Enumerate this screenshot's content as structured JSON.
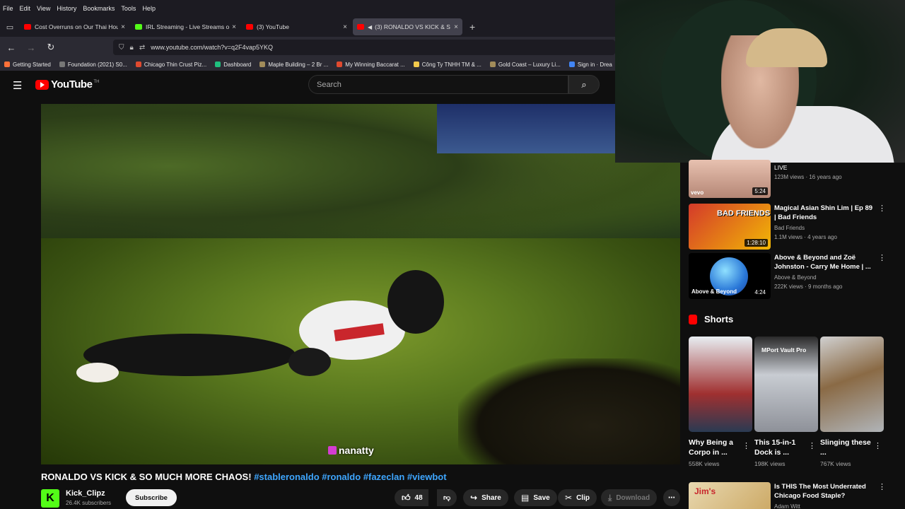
{
  "menu": [
    "File",
    "Edit",
    "View",
    "History",
    "Bookmarks",
    "Tools",
    "Help"
  ],
  "tabs": [
    {
      "title": "Cost Overruns on Our Thai Hou",
      "icon": "youtube-icon",
      "active": false
    },
    {
      "title": "IRL Streaming - Live Streams or",
      "icon": "kick-icon",
      "active": false
    },
    {
      "title": "(3) YouTube",
      "icon": "youtube-icon",
      "active": false
    },
    {
      "title": "(3) RONALDO VS KICK & S",
      "icon": "youtube-icon",
      "active": true
    }
  ],
  "url": "www.youtube.com/watch?v=q2F4vap5YKQ",
  "bookmarks": [
    {
      "label": "Getting Started",
      "color": "#ff7139"
    },
    {
      "label": "Foundation (2021) S0...",
      "color": "#777777"
    },
    {
      "label": "Chicago Thin Crust Piz...",
      "color": "#e04a2f"
    },
    {
      "label": "Dashboard",
      "color": "#1fbf7e"
    },
    {
      "label": "Maple Building – 2 Br ...",
      "color": "#a28c5a"
    },
    {
      "label": "My Winning Baccarat ...",
      "color": "#e04a2f"
    },
    {
      "label": "Công Ty TNHH TM & ...",
      "color": "#f2c94c"
    },
    {
      "label": "Gold Coast – Luxury Li...",
      "color": "#a28c5a"
    },
    {
      "label": "Sign in · Drea",
      "color": "#4285f4"
    }
  ],
  "youtube": {
    "logo_text": "YouTube",
    "logo_tm": "TH",
    "search_placeholder": "Search"
  },
  "video": {
    "watermark": "nanatty",
    "title_main": "RONALDO VS KICK & SO MUCH MORE CHAOS!",
    "hashtags": "#stableronaldo #ronaldo #fazeclan #viewbot",
    "channel_name": "Kick_Clipz",
    "channel_avatar_letter": "K",
    "subscribers": "26.4K subscribers",
    "subscribe_label": "Subscribe",
    "likes": "48",
    "share_label": "Share",
    "save_label": "Save",
    "clip_label": "Clip",
    "download_label": "Download"
  },
  "sidebar": {
    "items": [
      {
        "title": "",
        "channel": "LIVE",
        "meta": "123M views · 16 years ago",
        "duration": "5:24",
        "thumb_color": "#c49a8a",
        "badge": "vevo"
      },
      {
        "title": "Magical Asian Shin Lim | Ep 89 | Bad Friends",
        "channel": "Bad Friends",
        "meta": "1.1M views · 4 years ago",
        "duration": "1:28:10",
        "thumb_color": "#d43a2a",
        "badge": "BAD FRIENDS"
      },
      {
        "title": "Above & Beyond and Zoë Johnston - Carry Me Home | ...",
        "channel": "Above & Beyond",
        "meta": "222K views · 9 months ago",
        "duration": "4:24",
        "thumb_color": "#2a78d8",
        "badge": "Above & Beyond"
      }
    ],
    "shorts_label": "Shorts",
    "shorts": [
      {
        "title": "Why Being a Corpo in ...",
        "views": "558K views",
        "thumb_color": "#9a2a2a",
        "overlay": ""
      },
      {
        "title": "This 15-in-1 Dock is ...",
        "views": "198K views",
        "thumb_color": "#8e9199",
        "overlay": "MPort Vault Pro"
      },
      {
        "title": "Slinging these ...",
        "views": "767K views",
        "thumb_color": "#8a6a45",
        "overlay": ""
      }
    ],
    "bottom_item": {
      "title": "Is THIS The Most Underrated Chicago Food Staple?",
      "channel": "Adam Witt",
      "thumb_color": "#c8a25a",
      "badge": "Jim's"
    }
  }
}
